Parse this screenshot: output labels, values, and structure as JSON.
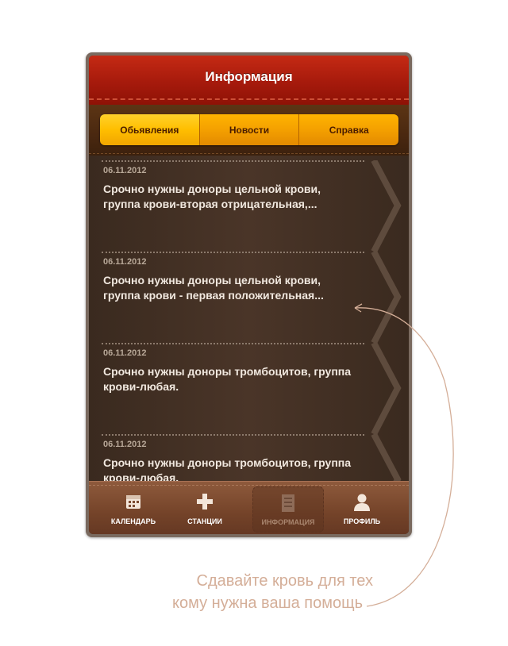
{
  "nav": {
    "title": "Информация"
  },
  "segments": [
    {
      "label": "Обьявления",
      "active": true
    },
    {
      "label": "Новости",
      "active": false
    },
    {
      "label": "Справка",
      "active": false
    }
  ],
  "news": [
    {
      "date": "06.11.2012",
      "text": "Срочно нужны доноры цельной крови, группа крови-вторая отрицательная,..."
    },
    {
      "date": "06.11.2012",
      "text": "Срочно нужны доноры цельной крови, группа крови - первая положительная..."
    },
    {
      "date": "06.11.2012",
      "text": "Срочно нужны доноры тромбоцитов, группа крови-любая."
    },
    {
      "date": "06.11.2012",
      "text": "Срочно нужны доноры тромбоцитов, группа крови-любая."
    }
  ],
  "tabs": [
    {
      "label": "КАЛЕНДАРЬ",
      "icon": "calendar-icon"
    },
    {
      "label": "СТАНЦИИ",
      "icon": "plus-icon"
    },
    {
      "label": "ИНФОРМАЦИЯ",
      "icon": "document-icon",
      "selected": true
    },
    {
      "label": "ПРОФИЛЬ",
      "icon": "person-icon"
    }
  ],
  "caption": {
    "line1": "Сдавайте кровь для тех",
    "line2": "кому нужна ваша помощь"
  },
  "colors": {
    "nav": "#a61a0c",
    "segment": "#ffb400",
    "list_bg": "#3a2a1f",
    "tabbar": "#744329",
    "caption": "#d4ae98"
  }
}
